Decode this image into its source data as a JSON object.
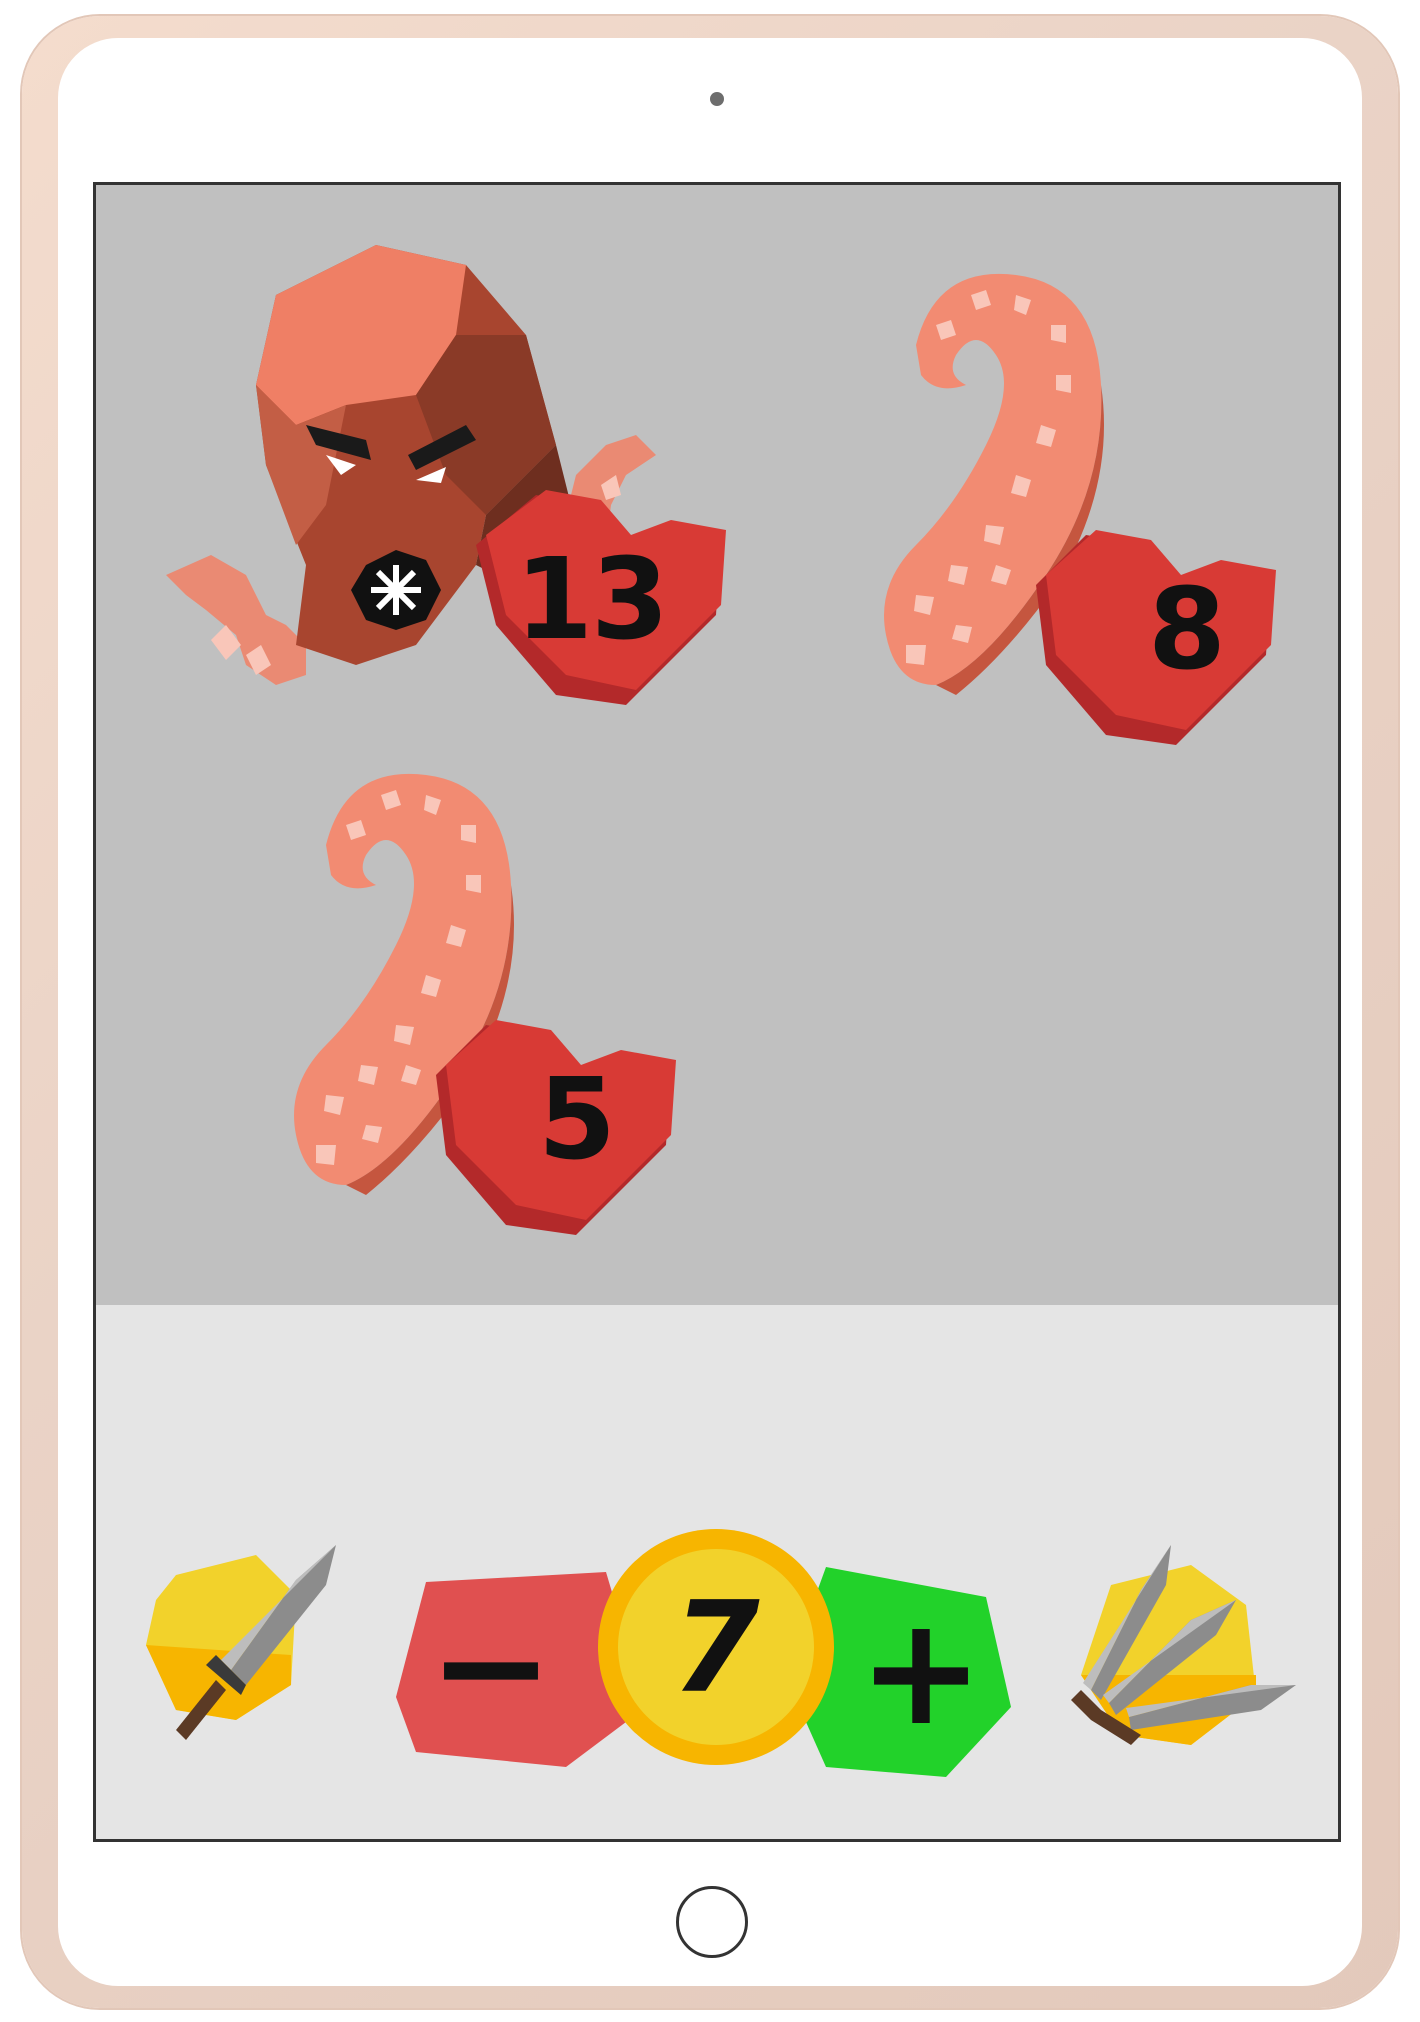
{
  "game": {
    "enemies": [
      {
        "kind": "octopus",
        "health": "13"
      },
      {
        "kind": "tentacle",
        "health": "8"
      },
      {
        "kind": "tentacle",
        "health": "5"
      }
    ],
    "controls": {
      "single_weapon_icon": "sword-icon",
      "minus_label": "−",
      "value": "7",
      "plus_label": "+",
      "multi_weapon_icon": "triple-blade-icon"
    },
    "colors": {
      "battle_background": "#c0c0c0",
      "control_background": "#e5e5e5",
      "heart": "#d83a35",
      "minus_button": "#e05050",
      "plus_button": "#22d22a",
      "coin": "#f2d22b",
      "coin_ring": "#f7b500",
      "octopus": "#a8452f",
      "tentacle": "#f28b72"
    }
  }
}
